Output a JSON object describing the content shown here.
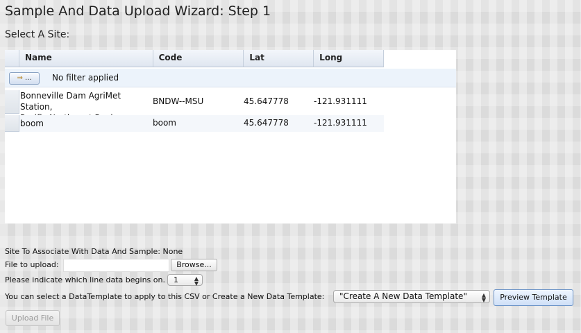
{
  "page": {
    "title": "Sample And Data Upload Wizard: Step 1",
    "subtitle": "Select A Site:"
  },
  "grid": {
    "columns": [
      "Name",
      "Code",
      "Lat",
      "Long"
    ],
    "filter_button_icon": "filter-icon",
    "filter_button_label": "...",
    "filter_text": "No filter applied",
    "rows": [
      {
        "name_line1": "Bonneville Dam AgriMet Station,",
        "name_line2": "Pacific Northwest Region",
        "code": "BNDW--MSU",
        "lat": "45.647778",
        "long": "-121.931111"
      },
      {
        "name_line1": "boom",
        "name_line2": "",
        "code": "boom",
        "lat": "45.647778",
        "long": "-121.931111"
      }
    ]
  },
  "form": {
    "site_assoc_label": "Site To Associate With Data And Sample: None",
    "file_label": "File to upload:",
    "browse_label": "Browse...",
    "line_label": "Please indicate which line data begins on.",
    "line_value": "1",
    "template_label": "You can select a DataTemplate to apply to this CSV or Create a New Data Template:",
    "template_value": "\"Create A New Data Template\"",
    "preview_label": "Preview Template",
    "upload_label": "Upload File"
  }
}
